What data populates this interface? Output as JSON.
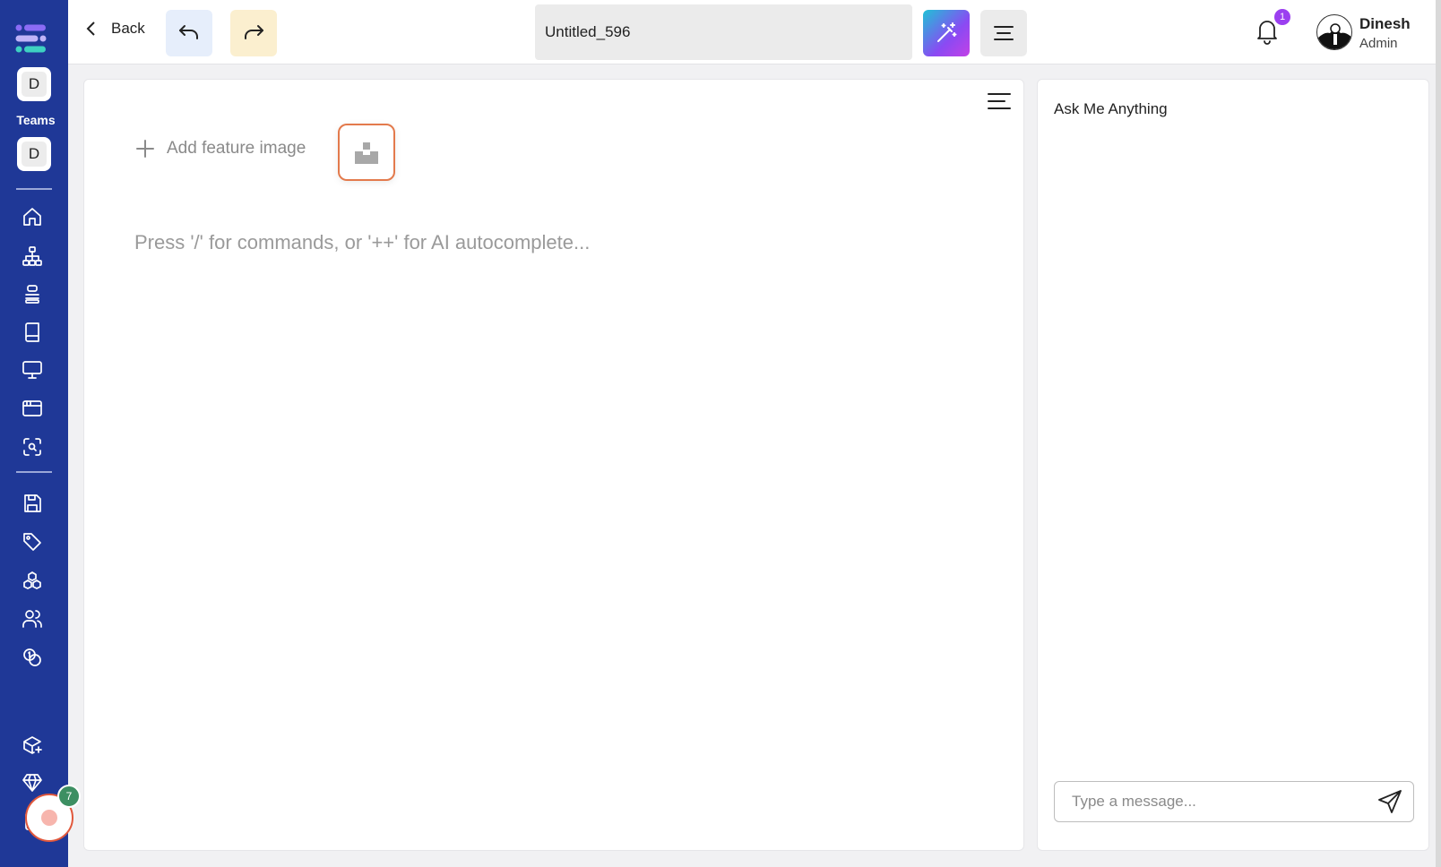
{
  "sidebar": {
    "team_badge_top": "D",
    "teams_label": "Teams",
    "team_badge_bottom": "D",
    "nav_icons": [
      "home-icon",
      "sitemap-icon",
      "stack-icon",
      "book-icon",
      "monitor-icon",
      "browser-window-icon",
      "scan-search-icon",
      "save-icon",
      "tag-icon",
      "cubes-icon",
      "users-icon",
      "coins-icon",
      "box-plus-icon",
      "diamond-icon",
      "clipboard-icon"
    ],
    "record_count": "7"
  },
  "topbar": {
    "back_label": "Back",
    "document_title": "Untitled_596",
    "notification_count": "1",
    "user_name": "Dinesh",
    "user_role": "Admin"
  },
  "editor": {
    "add_feature_label": "Add feature image",
    "placeholder": "Press '/' for commands, or '++' for AI autocomplete..."
  },
  "chat": {
    "title": "Ask Me Anything",
    "input_placeholder": "Type a message..."
  },
  "colors": {
    "sidebar_bg": "#1f3897",
    "accent_orange": "#e37a4c",
    "badge_purple": "#9b3ff0",
    "badge_green": "#3d8f62"
  }
}
